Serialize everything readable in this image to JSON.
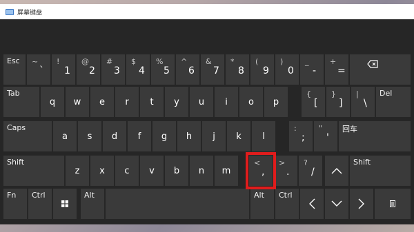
{
  "window": {
    "title": "屏幕键盘"
  },
  "keys": {
    "esc": "Esc",
    "tab": "Tab",
    "caps": "Caps",
    "shift": "Shift",
    "fn": "Fn",
    "ctrl": "Ctrl",
    "alt": "Alt",
    "del": "Del",
    "enter": "回车"
  },
  "num_row": [
    {
      "s": "~",
      "m": "`"
    },
    {
      "s": "!",
      "m": "1"
    },
    {
      "s": "@",
      "m": "2"
    },
    {
      "s": "#",
      "m": "3"
    },
    {
      "s": "$",
      "m": "4"
    },
    {
      "s": "%",
      "m": "5"
    },
    {
      "s": "^",
      "m": "6"
    },
    {
      "s": "&",
      "m": "7"
    },
    {
      "s": "*",
      "m": "8"
    },
    {
      "s": "(",
      "m": "9"
    },
    {
      "s": ")",
      "m": "0"
    },
    {
      "s": "_",
      "m": "-"
    },
    {
      "s": "+",
      "m": "="
    }
  ],
  "qwerty": [
    "q",
    "w",
    "e",
    "r",
    "t",
    "y",
    "u",
    "i",
    "o",
    "p"
  ],
  "brackets": [
    {
      "s": "{",
      "m": "["
    },
    {
      "s": "}",
      "m": "]"
    },
    {
      "s": "|",
      "m": "\\"
    }
  ],
  "home": [
    "a",
    "s",
    "d",
    "f",
    "g",
    "h",
    "j",
    "k",
    "l"
  ],
  "semi": [
    {
      "s": ":",
      "m": ";"
    },
    {
      "s": "\"",
      "m": "'"
    }
  ],
  "bottom_letters": [
    "z",
    "x",
    "c",
    "v",
    "b",
    "n",
    "m"
  ],
  "punct": [
    {
      "s": "<",
      "m": ","
    },
    {
      "s": ">",
      "m": "."
    },
    {
      "s": "?",
      "m": "/"
    }
  ],
  "icons": [
    "backspace-icon",
    "windows-icon",
    "arrow-up-icon",
    "arrow-left-icon",
    "arrow-down-icon",
    "arrow-right-icon",
    "keyboard-menu-icon"
  ]
}
